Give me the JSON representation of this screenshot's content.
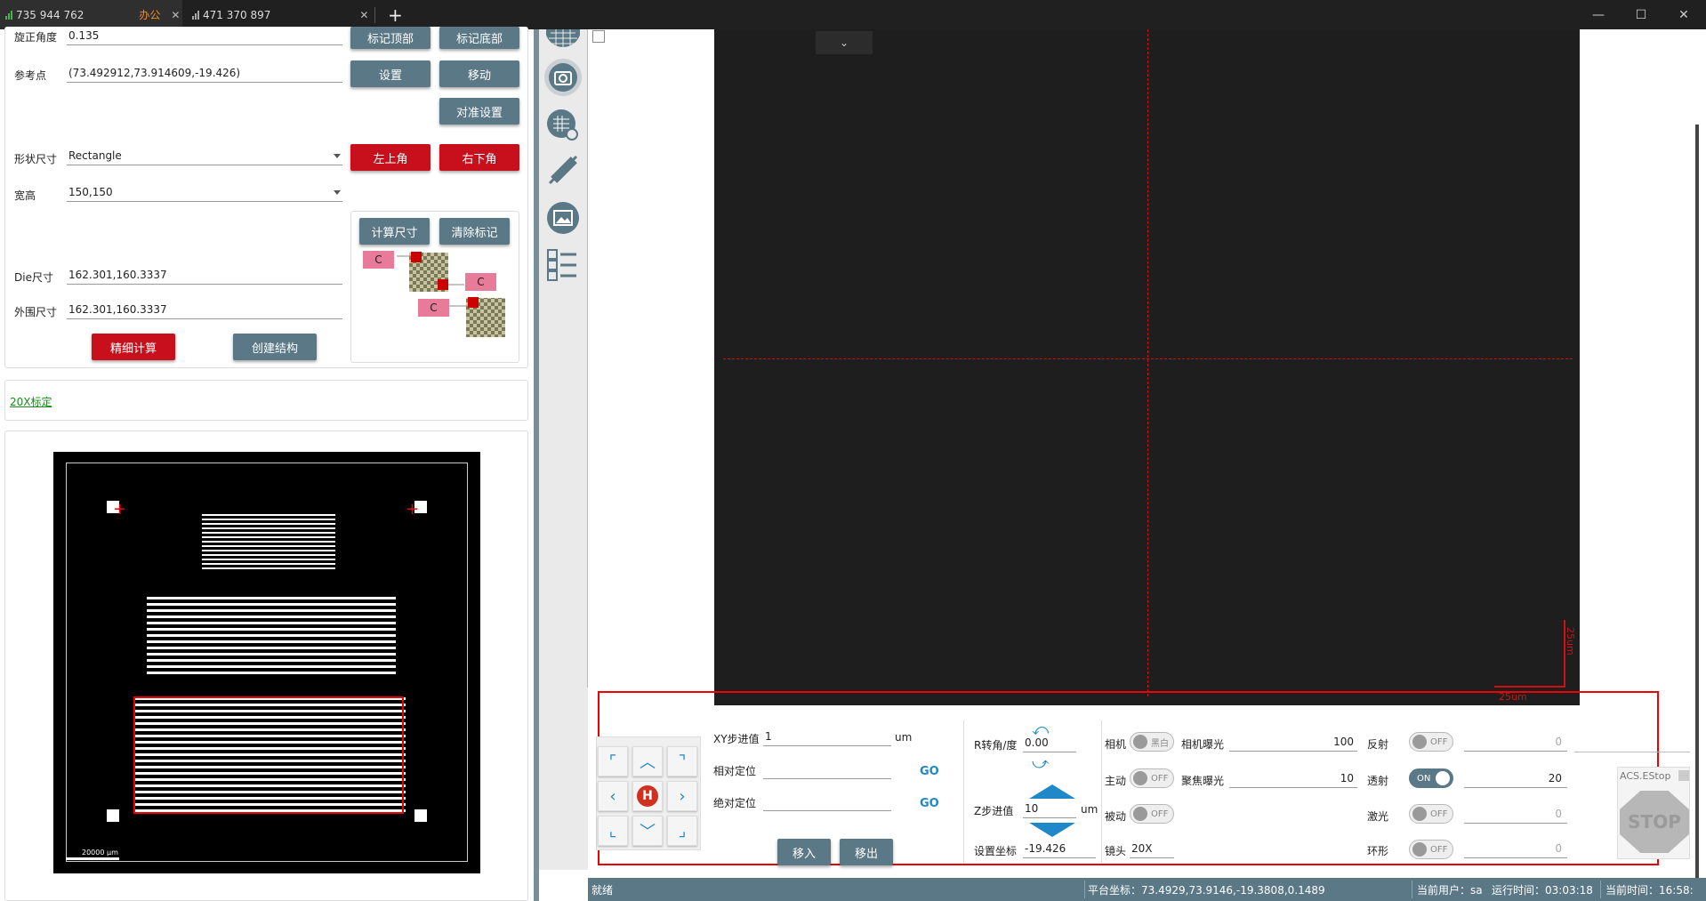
{
  "tabs": [
    {
      "id": "735 944 762",
      "tag": "办公",
      "close": "✕"
    },
    {
      "id": "471 370 897",
      "close": "✕"
    }
  ],
  "new_tab": "+",
  "window_controls": {
    "minimize": "—",
    "maximize": "☐",
    "close": "✕"
  },
  "form": {
    "rotate_angle": {
      "label": "旋正角度",
      "value": "0.135"
    },
    "ref_point": {
      "label": "参考点",
      "value": "(73.492912,73.914609,-19.426)"
    },
    "shape_size": {
      "label": "形状尺寸",
      "value": "Rectangle"
    },
    "width_height": {
      "label": "宽高",
      "value": "150,150"
    },
    "die_size": {
      "label": "Die尺寸",
      "value": "162.301,160.3337"
    },
    "outer_size": {
      "label": "外围尺寸",
      "value": "162.301,160.3337"
    }
  },
  "buttons": {
    "mark_top": "标记顶部",
    "mark_bottom": "标记底部",
    "set": "设置",
    "move": "移动",
    "align_settings": "对准设置",
    "top_left": "左上角",
    "bottom_right": "右下角",
    "calc_size": "计算尺寸",
    "clear_marks": "清除标记",
    "fine_calc": "精细计算",
    "create_structure": "创建结构",
    "move_in": "移入",
    "move_out": "移出"
  },
  "diagram": {
    "c_label": "C"
  },
  "calib_link": "20X标定",
  "map": {
    "scale_label": "20000 μm"
  },
  "camera": {
    "scale_x": "25um",
    "scale_y": "25um"
  },
  "motion": {
    "xy_step": {
      "label": "XY步进值",
      "value": "1",
      "unit": "um"
    },
    "relative": {
      "label": "相对定位",
      "value": ""
    },
    "absolute": {
      "label": "绝对定位",
      "value": ""
    },
    "go": "GO",
    "r_angle": {
      "label": "R转角/度",
      "value": "0.00"
    },
    "z_step": {
      "label": "Z步进值",
      "value": "10",
      "unit": "um"
    },
    "set_coord": {
      "label": "设置坐标",
      "value": "-19.426"
    },
    "home": "H"
  },
  "light": {
    "camera": {
      "label": "相机",
      "state": "黑白"
    },
    "active": {
      "label": "主动",
      "state": "OFF"
    },
    "passive": {
      "label": "被动",
      "state": "OFF"
    },
    "lens": {
      "label": "镜头",
      "value": "20X"
    },
    "cam_exposure": {
      "label": "相机曝光",
      "value": "100"
    },
    "focus_exposure": {
      "label": "聚焦曝光",
      "value": "10"
    },
    "reflect": {
      "label": "反射",
      "state": "OFF",
      "value": "0"
    },
    "transmit": {
      "label": "透射",
      "state": "ON",
      "value": "20"
    },
    "laser": {
      "label": "激光",
      "state": "OFF",
      "value": "0"
    },
    "ring": {
      "label": "环形",
      "state": "OFF",
      "value": "0"
    }
  },
  "acs": {
    "label": "ACS.EStop",
    "stop": "STOP"
  },
  "statusbar": {
    "ready": "就绪",
    "platform": "平台坐标：73.4929,73.9146,-19.3808,0.1489",
    "user": "当前用户：sa",
    "runtime": "运行时间：03:03:18",
    "time": "当前时间：16:58:"
  },
  "colors": {
    "accent": "#5b7887",
    "red": "#c8101c",
    "title_bg": "#202020",
    "camera_bg": "#1e1e1e"
  },
  "icons": [
    "grid-icon",
    "camera-icon",
    "wafer-settings-icon",
    "ruler-icon",
    "image-frame-icon",
    "checklist-icon"
  ]
}
